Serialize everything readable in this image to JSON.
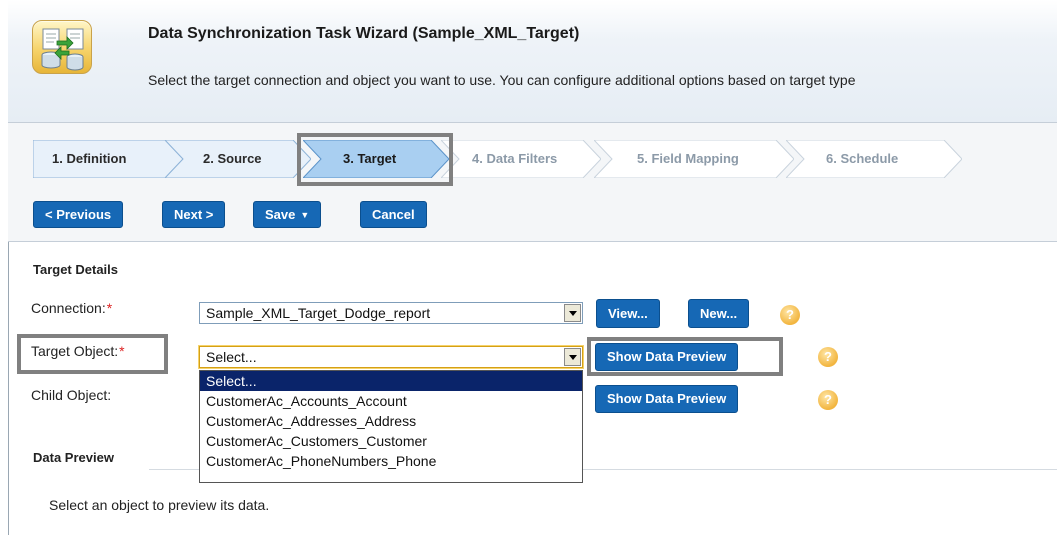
{
  "header": {
    "title": "Data Synchronization Task Wizard (Sample_XML_Target)",
    "description": "Select the target connection and object you want to use. You can configure additional options based on target type"
  },
  "steps": [
    {
      "label": "1. Definition",
      "state": "done"
    },
    {
      "label": "2. Source",
      "state": "done"
    },
    {
      "label": "3. Target",
      "state": "current"
    },
    {
      "label": "4. Data Filters",
      "state": "future"
    },
    {
      "label": "5. Field Mapping",
      "state": "future"
    },
    {
      "label": "6. Schedule",
      "state": "future"
    }
  ],
  "toolbar": {
    "previous_label": "< Previous",
    "next_label": "Next >",
    "save_label": "Save",
    "cancel_label": "Cancel"
  },
  "target_details": {
    "section_title": "Target Details",
    "connection_label": "Connection:",
    "connection_value": "Sample_XML_Target_Dodge_report",
    "view_label": "View...",
    "new_label": "New...",
    "target_object_label": "Target Object:",
    "target_object_value": "Select...",
    "show_preview_label": "Show Data Preview",
    "child_object_label": "Child Object:",
    "required_marker": "*",
    "help_glyph": "?"
  },
  "dropdown_options": [
    "Select...",
    "CustomerAc_Accounts_Account",
    "CustomerAc_Addresses_Address",
    "CustomerAc_Customers_Customer",
    "CustomerAc_PhoneNumbers_Phone"
  ],
  "data_preview": {
    "section_title": "Data Preview",
    "message": "Select an object to preview its data."
  },
  "colors": {
    "button_blue": "#1668b5",
    "step_done_fill": "#e8f1fa",
    "step_current_fill": "#a9cff1",
    "step_future_text": "#8c9aa8",
    "required_red": "#dd2222",
    "help_orange": "#f2b53f",
    "highlight_gray": "#808080"
  },
  "icons": {
    "app": "data-sync-icon",
    "help": "help-icon",
    "save_caret": "chevron-down-icon"
  }
}
